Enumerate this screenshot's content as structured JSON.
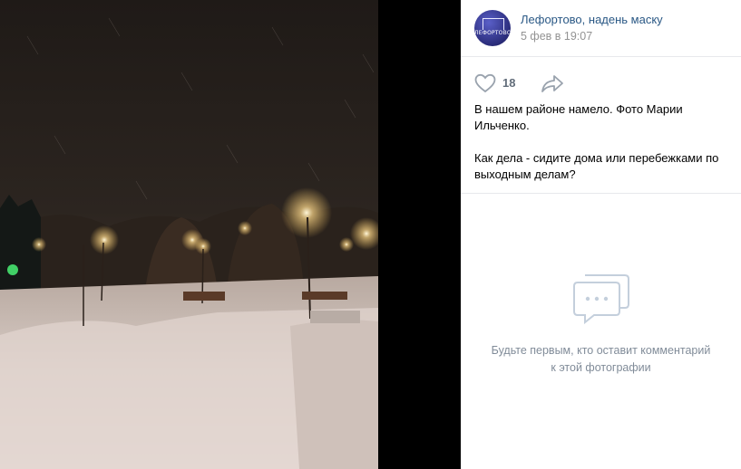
{
  "post": {
    "author": "Лефортово, надень маску",
    "date": "5 фев в 19:07",
    "avatar_text": "ЛЕФОРТОВО",
    "likes": "18",
    "description_line1": "В нашем районе намело. Фото Марии Ильченко.",
    "description_line2": "Как дела - сидите дома или перебежками по выходным делам?"
  },
  "comments": {
    "empty_text": "Будьте первым, кто оставит комментарий к этой фотографии"
  },
  "icons": {
    "like": "heart-icon",
    "share": "share-arrow-icon",
    "comments": "chat-bubble-icon"
  },
  "colors": {
    "link": "#2a5885",
    "muted": "#939393",
    "icon": "#99a2ad"
  }
}
